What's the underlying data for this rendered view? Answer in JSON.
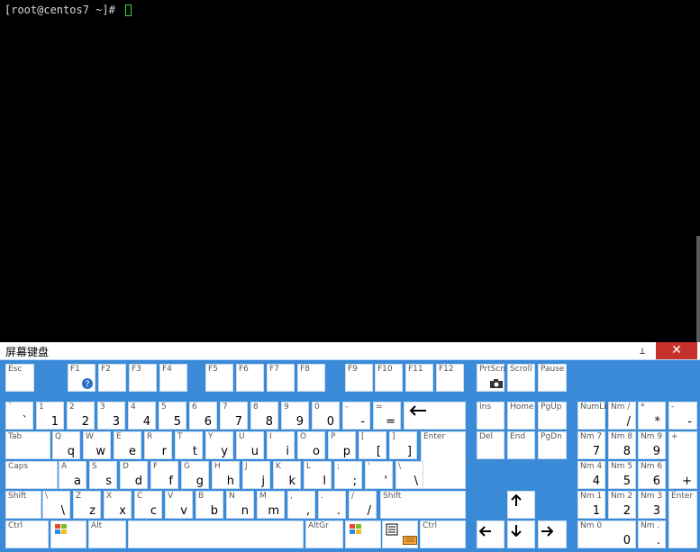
{
  "terminal": {
    "prompt": "[root@centos7 ~]# "
  },
  "osk": {
    "title": "屏幕键盘",
    "pin_glyph": "⊥",
    "close_glyph": "✕"
  },
  "keys": {
    "esc": "Esc",
    "f1": "F1",
    "f2": "F2",
    "f3": "F3",
    "f4": "F4",
    "f5": "F5",
    "f6": "F6",
    "f7": "F7",
    "f8": "F8",
    "f9": "F9",
    "f10": "F10",
    "f11": "F11",
    "f12": "F12",
    "prtsc": "PrtScn",
    "scroll": "Scroll",
    "pause": "Pause",
    "ins": "Ins",
    "home": "Home",
    "pgup": "PgUp",
    "del": "Del",
    "end": "End",
    "pgdn": "PgDn",
    "numlock": "NumLk",
    "nm_slash_top": "Nm /",
    "nm_slash": "/",
    "star_top": "*",
    "star": "*",
    "minus_top": "-",
    "minus": "-",
    "nm7": "Nm 7",
    "n7": "7",
    "nm8": "Nm 8",
    "n8": "8",
    "nm9": "Nm 9",
    "n9": "9",
    "plus_top": "+",
    "plus": "+",
    "nm4": "Nm 4",
    "n4": "4",
    "nm5": "Nm 5",
    "n5": "5",
    "nm6": "Nm 6",
    "n6": "6",
    "nm1": "Nm 1",
    "n1": "1",
    "nm2": "Nm 2",
    "n2": "2",
    "nm3": "Nm 3",
    "n3": "3",
    "nenter": "Enter",
    "nm0": "Nm 0",
    "n0": "0",
    "nmdot": "Nm .",
    "ndot": ".",
    "tab": "Tab",
    "caps": "Caps",
    "shift": "Shift",
    "rshift": "Shift",
    "ctrl": "Ctrl",
    "alt": "Alt",
    "altgr": "AltGr",
    "rctrl": "Ctrl",
    "enter": "Enter"
  },
  "rows": {
    "number": [
      {
        "u": "`",
        "l": "`"
      },
      {
        "u": "1",
        "l": "1"
      },
      {
        "u": "2",
        "l": "2"
      },
      {
        "u": "3",
        "l": "3"
      },
      {
        "u": "4",
        "l": "4"
      },
      {
        "u": "5",
        "l": "5"
      },
      {
        "u": "6",
        "l": "6"
      },
      {
        "u": "7",
        "l": "7"
      },
      {
        "u": "8",
        "l": "8"
      },
      {
        "u": "9",
        "l": "9"
      },
      {
        "u": "0",
        "l": "0"
      },
      {
        "u": "-",
        "l": "-"
      },
      {
        "u": "=",
        "l": "="
      }
    ],
    "q": [
      {
        "u": "Q",
        "l": "q"
      },
      {
        "u": "W",
        "l": "w"
      },
      {
        "u": "E",
        "l": "e"
      },
      {
        "u": "R",
        "l": "r"
      },
      {
        "u": "T",
        "l": "t"
      },
      {
        "u": "Y",
        "l": "y"
      },
      {
        "u": "U",
        "l": "u"
      },
      {
        "u": "I",
        "l": "i"
      },
      {
        "u": "O",
        "l": "o"
      },
      {
        "u": "P",
        "l": "p"
      },
      {
        "u": "[",
        "l": "["
      },
      {
        "u": "]",
        "l": "]"
      }
    ],
    "a": [
      {
        "u": "A",
        "l": "a"
      },
      {
        "u": "S",
        "l": "s"
      },
      {
        "u": "D",
        "l": "d"
      },
      {
        "u": "F",
        "l": "f"
      },
      {
        "u": "G",
        "l": "g"
      },
      {
        "u": "H",
        "l": "h"
      },
      {
        "u": "J",
        "l": "j"
      },
      {
        "u": "K",
        "l": "k"
      },
      {
        "u": "L",
        "l": "l"
      },
      {
        "u": ";",
        "l": ";"
      },
      {
        "u": "'",
        "l": "'"
      },
      {
        "u": "\\",
        "l": "\\"
      }
    ],
    "z": [
      {
        "u": "\\",
        "l": "\\"
      },
      {
        "u": "Z",
        "l": "z"
      },
      {
        "u": "X",
        "l": "x"
      },
      {
        "u": "C",
        "l": "c"
      },
      {
        "u": "V",
        "l": "v"
      },
      {
        "u": "B",
        "l": "b"
      },
      {
        "u": "N",
        "l": "n"
      },
      {
        "u": "M",
        "l": "m"
      },
      {
        "u": ",",
        "l": ","
      },
      {
        "u": ".",
        "l": "."
      },
      {
        "u": "/",
        "l": "/"
      }
    ]
  },
  "icons": {
    "help": "help-icon",
    "backspace": "backspace-arrow-icon",
    "windows": "windows-logo-icon",
    "menu": "menu-key-icon",
    "camera": "camera-icon",
    "arrow_up": "arrow-up-icon",
    "arrow_left": "arrow-left-icon",
    "arrow_down": "arrow-down-icon",
    "arrow_right": "arrow-right-icon"
  },
  "colors": {
    "terminal_bg": "#000000",
    "terminal_text": "#d9d9d9",
    "cursor": "#35d935",
    "keyboard_bg": "#3a8ad8",
    "key_face": "#ffffff",
    "close_button": "#c7312b"
  }
}
